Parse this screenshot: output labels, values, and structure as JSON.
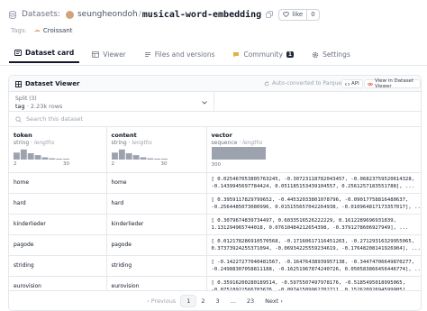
{
  "header": {
    "section": "Datasets:",
    "owner": "seungheondoh",
    "separator": "/",
    "repo_name": "musical-word-embedding",
    "like_label": "like",
    "like_count": "0"
  },
  "tags": {
    "label": "Tags:",
    "items": [
      "Croissant"
    ]
  },
  "tabs": [
    {
      "label": "Dataset card",
      "active": true
    },
    {
      "label": "Viewer",
      "active": false
    },
    {
      "label": "Files and versions",
      "active": false
    },
    {
      "label": "Community",
      "active": false,
      "badge": "1"
    },
    {
      "label": "Settings",
      "active": false
    }
  ],
  "viewer": {
    "title": "Dataset Viewer",
    "auto_converted": "Auto-converted to Parquet",
    "api_label": "API",
    "view_button": "View in Dataset Viewer",
    "split_label": "Split (3)",
    "split_value": "tag",
    "split_rows": "· 2.23k rows",
    "search_placeholder": "Search this dataset"
  },
  "columns": [
    {
      "name": "token",
      "type": "string",
      "stat": "lengths",
      "min": "2",
      "max": "30",
      "hist": [
        0.55,
        0.8,
        0.5,
        0.35,
        0.18,
        0.1,
        0.06,
        0.03
      ]
    },
    {
      "name": "content",
      "type": "string",
      "stat": "lengths",
      "min": "2",
      "max": "30",
      "hist": [
        0.55,
        0.8,
        0.5,
        0.35,
        0.18,
        0.1,
        0.06,
        0.03
      ]
    },
    {
      "name": "vector",
      "type": "sequence",
      "stat": "lengths",
      "value": "300",
      "hist": [
        1.0
      ]
    }
  ],
  "rows": [
    {
      "token": "home",
      "content": "home",
      "vector": "[ 0.025467053805763245, -0.30723118782043457, -0.06823759520614328,\n-0.1439945697784424, 0.051185153439104557, 0.2561257183551788], ..."
    },
    {
      "token": "hard",
      "content": "hard",
      "vector": "[ 0.3959117829799652, -0.44532033801078796, -0.09017758816480637,\n-0.2564485073080996, 0.015155657042264938, -0.010964817173357017], ..."
    },
    {
      "token": "kinderlieder",
      "content": "kinderlieder",
      "vector": "[ 0.3079674839734497, 0.6033516526222229, 0.1612289696931839,\n1.131294965744018, 0.07610484212654398, -0.3791278606927949], ..."
    },
    {
      "token": "pagode",
      "content": "pagode",
      "vector": "[ 0.012178286910570568, -0.17160617116451263, -0.27129316329955065,\n0.37373924255371094, -0.06934225559234619, -0.17648208141926904], ..."
    },
    {
      "token": "striding",
      "content": "striding",
      "vector": "[ -0.14227277040481567, -0.16476438939957138, -0.34474706649870277,\n-0.24988307058811188, -0.16251967874240726, 0.050583866456446774], ..."
    },
    {
      "token": "eurovision",
      "content": "eurovision",
      "vector": "[ 0.35916200280189514, -0.5975507497978176, -0.5185495018995065,\n-0.07518922566783676, -0.09741509962702711, 0.15262092694599905], ..."
    }
  ],
  "pagination": {
    "prev": "‹ Previous",
    "pages": [
      "1",
      "2",
      "3",
      "...",
      "23"
    ],
    "current": "1",
    "next": "Next ›"
  },
  "colors": {
    "accent": "#111827",
    "hist_bar": "#9ca3af",
    "avatar": "#d1a37a",
    "croissant": "#e0863a"
  }
}
